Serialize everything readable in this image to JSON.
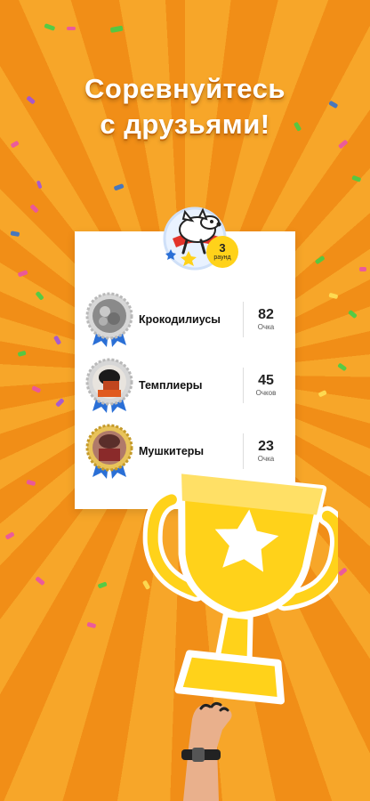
{
  "headline": {
    "line1": "Соревнуйтесь",
    "line2": "с друзьями!"
  },
  "round": {
    "number": "3",
    "label": "раунд"
  },
  "leaderboard": [
    {
      "team": "Крокодилиусы",
      "score": "82",
      "unit": "Очка",
      "medal": "silver",
      "avatar": "crocodile-avatar"
    },
    {
      "team": "Темплиеры",
      "score": "45",
      "unit": "Очков",
      "medal": "silver",
      "avatar": "templar-avatar"
    },
    {
      "team": "Мушкитеры",
      "score": "23",
      "unit": "Очка",
      "medal": "gold",
      "avatar": "musketeer-avatar"
    }
  ],
  "colors": {
    "background": "#f59b1c",
    "trophy": "#ffd21a",
    "badge": "#ffd21a",
    "ribbon": "#2a6fd6"
  }
}
